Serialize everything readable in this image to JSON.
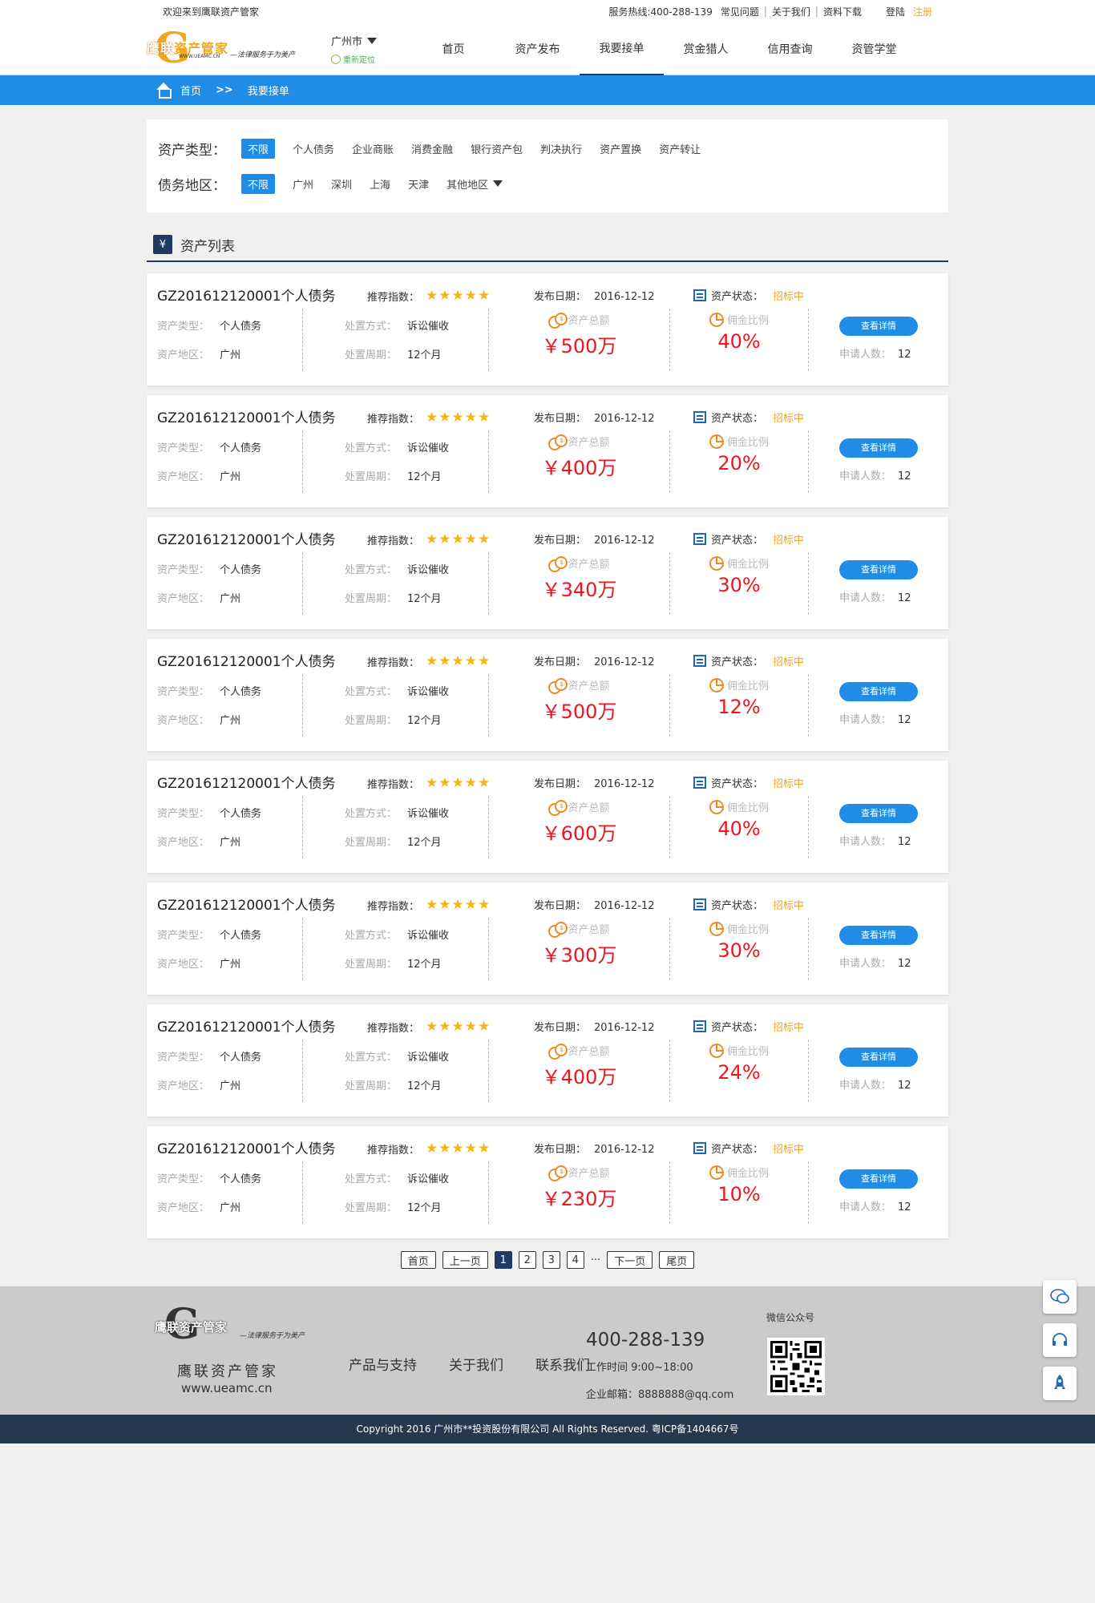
{
  "topbar": {
    "welcome": "欢迎来到鹰联资产管家",
    "hotline": "服务热线:400-288-139",
    "faq": "常见问题",
    "about": "关于我们",
    "download": "资料下载",
    "login": "登陆",
    "register": "注册",
    "sep": "|"
  },
  "logo": {
    "name_a": "鹰联",
    "name_b": "资产管家",
    "url": "WWW.UEAMC.CN",
    "slogan": "—法律服务于为美产",
    "letter": "G"
  },
  "city": {
    "name": "广州市",
    "locate": "重新定位"
  },
  "nav": [
    "首页",
    "资产发布",
    "我要接单",
    "赏金猎人",
    "信用查询",
    "资管学堂"
  ],
  "crumb": {
    "home": "首页",
    "arrows": ">>",
    "current": "我要接单"
  },
  "filters": {
    "type_label": "资产类型：",
    "types": [
      "不限",
      "个人债务",
      "企业商账",
      "消费金融",
      "银行资产包",
      "判决执行",
      "资产置换",
      "资产转让"
    ],
    "area_label": "债务地区：",
    "areas": [
      "不限",
      "广州",
      "深圳",
      "上海",
      "天津",
      "其他地区"
    ]
  },
  "section_title": "资产列表",
  "item_labels": {
    "rec": "推荐指数：",
    "pub": "发布日期：",
    "status": "资产状态：",
    "type": "资产类型：",
    "area": "资产地区：",
    "method": "处置方式：",
    "period": "处置周期：",
    "amount": "资产总额",
    "ratio": "佣金比例",
    "button": "查看详情",
    "apply": "申请人数："
  },
  "items": [
    {
      "code": "GZ201612120001个人债务",
      "stars": "★★★★★",
      "date": "2016-12-12",
      "status": "招标中",
      "type": "个人债务",
      "area": "广州",
      "method": "诉讼催收",
      "period": "12个月",
      "amount": "￥500万",
      "ratio": "40%",
      "apply": "12"
    },
    {
      "code": "GZ201612120001个人债务",
      "stars": "★★★★★",
      "date": "2016-12-12",
      "status": "招标中",
      "type": "个人债务",
      "area": "广州",
      "method": "诉讼催收",
      "period": "12个月",
      "amount": "￥400万",
      "ratio": "20%",
      "apply": "12"
    },
    {
      "code": "GZ201612120001个人债务",
      "stars": "★★★★★",
      "date": "2016-12-12",
      "status": "招标中",
      "type": "个人债务",
      "area": "广州",
      "method": "诉讼催收",
      "period": "12个月",
      "amount": "￥340万",
      "ratio": "30%",
      "apply": "12"
    },
    {
      "code": "GZ201612120001个人债务",
      "stars": "★★★★★",
      "date": "2016-12-12",
      "status": "招标中",
      "type": "个人债务",
      "area": "广州",
      "method": "诉讼催收",
      "period": "12个月",
      "amount": "￥500万",
      "ratio": "12%",
      "apply": "12"
    },
    {
      "code": "GZ201612120001个人债务",
      "stars": "★★★★★",
      "date": "2016-12-12",
      "status": "招标中",
      "type": "个人债务",
      "area": "广州",
      "method": "诉讼催收",
      "period": "12个月",
      "amount": "￥600万",
      "ratio": "40%",
      "apply": "12"
    },
    {
      "code": "GZ201612120001个人债务",
      "stars": "★★★★★",
      "date": "2016-12-12",
      "status": "招标中",
      "type": "个人债务",
      "area": "广州",
      "method": "诉讼催收",
      "period": "12个月",
      "amount": "￥300万",
      "ratio": "30%",
      "apply": "12"
    },
    {
      "code": "GZ201612120001个人债务",
      "stars": "★★★★★",
      "date": "2016-12-12",
      "status": "招标中",
      "type": "个人债务",
      "area": "广州",
      "method": "诉讼催收",
      "period": "12个月",
      "amount": "￥400万",
      "ratio": "24%",
      "apply": "12"
    },
    {
      "code": "GZ201612120001个人债务",
      "stars": "★★★★★",
      "date": "2016-12-12",
      "status": "招标中",
      "type": "个人债务",
      "area": "广州",
      "method": "诉讼催收",
      "period": "12个月",
      "amount": "￥230万",
      "ratio": "10%",
      "apply": "12"
    }
  ],
  "pager": {
    "first": "首页",
    "prev": "上一页",
    "pages": [
      "1",
      "2",
      "3",
      "4"
    ],
    "ellipsis": "···",
    "next": "下一页",
    "last": "尾页",
    "current": "1"
  },
  "footer": {
    "name": "鹰联资产管家",
    "url": "www.ueamc.cn",
    "links": [
      "产品与支持",
      "关于我们",
      "联系我们"
    ],
    "phone": "400-288-139",
    "hours": "工作时间    9:00~18:00",
    "mail": "企业邮箱：8888888@qq.com",
    "wechat": "微信公众号",
    "copyright": "Copyright 2016 广州市**投资股份有限公司 All Rights Reserved. 粤ICP备1404667号"
  },
  "side_icons": [
    "wechat-icon",
    "headset-icon",
    "rocket-icon"
  ],
  "colors": {
    "primary": "#1f8ce6",
    "dark": "#1f3a63",
    "accent": "#f6a623",
    "price": "#f0141e"
  }
}
